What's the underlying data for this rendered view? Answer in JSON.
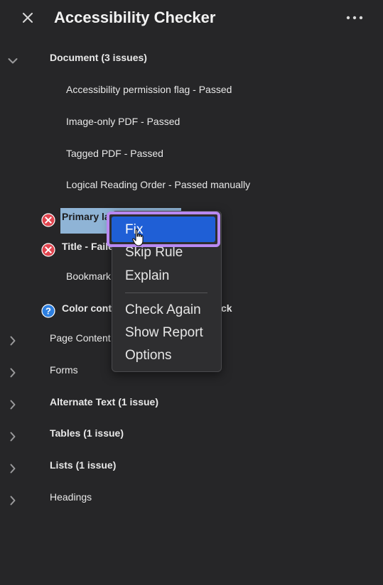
{
  "panel": {
    "title": "Accessibility Checker",
    "close_icon": "close-icon",
    "more_icon": "more-options-icon"
  },
  "document": {
    "label": "Document (3 issues)",
    "expanded": true,
    "items": [
      {
        "label": "Accessibility permission flag - Passed"
      },
      {
        "label": "Image-only PDF - Passed"
      },
      {
        "label": "Tagged PDF - Passed"
      },
      {
        "label": "Logical Reading Order - Passed manually"
      },
      {
        "label": "Primary la",
        "status": "failed",
        "icon": "error-icon"
      },
      {
        "label": "Title - Faile",
        "status": "failed",
        "icon": "error-icon"
      },
      {
        "label": "Bookmark"
      },
      {
        "label": "Color contr",
        "label_tail": "ck",
        "status": "manual",
        "icon": "question-icon"
      }
    ]
  },
  "categories": [
    {
      "label": "Page Content",
      "bold": false
    },
    {
      "label": "Forms",
      "bold": false
    },
    {
      "label": "Alternate Text (1 issue)",
      "bold": true
    },
    {
      "label": "Tables (1 issue)",
      "bold": true
    },
    {
      "label": "Lists (1 issue)",
      "bold": true
    },
    {
      "label": "Headings",
      "bold": false
    }
  ],
  "context_menu": {
    "items": [
      {
        "label": "Fix",
        "selected": true
      },
      {
        "label": "Skip Rule"
      },
      {
        "label": "Explain"
      },
      {
        "label": "Check Again"
      },
      {
        "label": "Show Report"
      },
      {
        "label": "Options"
      }
    ]
  },
  "colors": {
    "background": "#262628",
    "selected_item": "#1f5fd6",
    "focus_ring": "#b889f2",
    "row_highlight": "#8fb4d6",
    "error": "#e0454f",
    "help": "#2d7fe0"
  }
}
